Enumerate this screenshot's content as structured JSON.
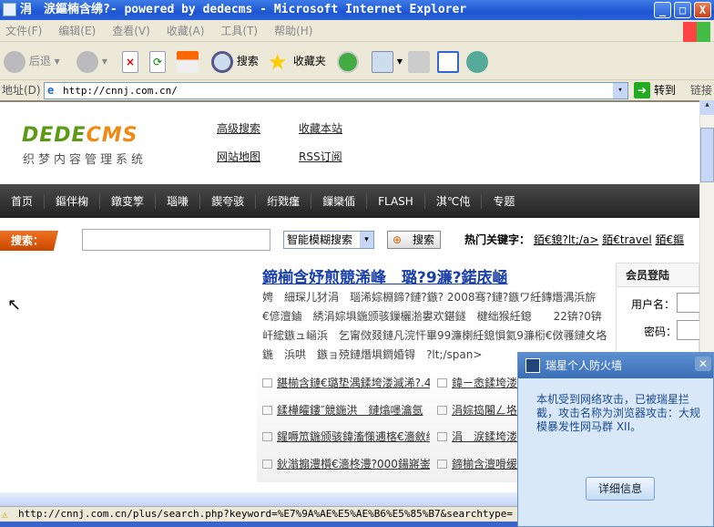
{
  "window": {
    "title": "涓　涙鏂楠含绋?- powered by dedecms - Microsoft Internet Explorer",
    "min": "_",
    "max": "□",
    "close": "X"
  },
  "menu": [
    "文件(F)",
    "编辑(E)",
    "查看(V)",
    "收藏(A)",
    "工具(T)",
    "帮助(H)"
  ],
  "toolbar": {
    "back": "后退",
    "search": "搜索",
    "favorites": "收藏夹"
  },
  "address": {
    "label": "地址(D)",
    "url": "http://cnnj.com.cn/",
    "go": "转到",
    "links": "链接"
  },
  "site": {
    "logo": "DEDE",
    "logo_accent": "CMS",
    "logo_sub": "织梦内容管理系统",
    "links": [
      "高级搜索",
      "收藏本站",
      "网站地图",
      "RSS订阅"
    ]
  },
  "nav": [
    "首页",
    "鏂伴椈",
    "鐓变箰",
    "瑙嗛",
    "鍥夸骇",
    "绗戣瘽",
    "鏁欒偛",
    "FLASH",
    "淇℃伅",
    "专题"
  ],
  "search": {
    "label": "搜索：",
    "value": "",
    "mode": "智能模糊搜索",
    "button": "搜索",
    "hot_label": "热门关键字：",
    "hot": [
      "銆€鎴?lt;/a>",
      "銆€travel",
      "銆€鏂"
    ]
  },
  "headline": "鍗椾含妤煎競浠峰　璐?9濂?鍩庡崡",
  "summary": "娉　細琛儿犲涓　瑙浠婃棩鍗?鏈?鏃? 2008骞?鏈?鏃ワ紝鏄熸湡浜旂€偐澶鏀　綉涓婃埧鍦颁骇鏁欐湁婁欢鍖鐩　楗绌猴紝鎴　　22锛?0锛屽綋鏃ュ崡浜　乞甯傚叕鏈凡浣忓畢99濂楋紝鎴愪氦9濂椼€傚彟鏈夊垎鍦　浜哄　鏃ョ殑鏈熸埧鐧婚锝　?lt;/span>",
  "news": [
    [
      "鍖椾含鏈€璐垫湡鍒垮溇滅浠?.46",
      "鍏ㄧ悆鍒垮溇"
    ],
    [
      "鍒樺皬鏤″競鍦洪　鏈熻嚜瀹氬",
      "涓婃捣闂ㄥ垎"
    ],
    [
      "鍟嗕笟鍦颁骇鍏滀憡逋楁€濇斂绛",
      "涓　涙鍒垮溇"
    ],
    [
      "鈥滃搧澧櫍€濇柊澧?000鍚嶈崟",
      "鍗椾含澶嗗缓"
    ]
  ],
  "login": {
    "title": "会员登陆",
    "username": "用户名：",
    "password": "密码："
  },
  "firewall": {
    "title": "瑞星个人防火墙",
    "message": "本机受到网络攻击，已被瑞星拦截，攻击名称为浏览器攻击：大规模暴发性网马群 XII。",
    "button": "详细信息"
  },
  "status": {
    "url": "http://cnnj.com.cn/plus/search.php?keyword=%E7%9A%AE%E5%AE%B6%E5%85%B7&searchtype="
  }
}
